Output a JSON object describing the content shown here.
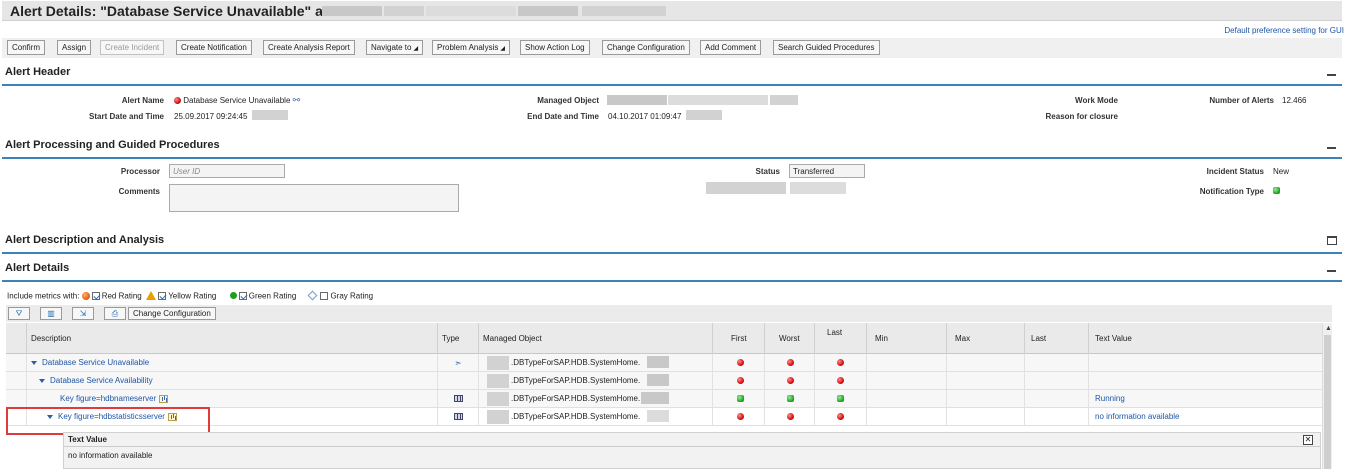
{
  "title": "Alert Details: \"Database Service Unavailable\" at",
  "pref_link": "Default preference setting for GUI",
  "toolbar": [
    {
      "label": "Confirm",
      "disabled": false,
      "dropdown": false
    },
    {
      "label": "Assign",
      "disabled": false,
      "dropdown": false
    },
    {
      "label": "Create Incident",
      "disabled": true,
      "dropdown": false
    },
    {
      "label": "Create Notification",
      "disabled": false,
      "dropdown": false
    },
    {
      "label": "Create Analysis Report",
      "disabled": false,
      "dropdown": false
    },
    {
      "label": "Navigate to",
      "disabled": false,
      "dropdown": true
    },
    {
      "label": "Problem Analysis",
      "disabled": false,
      "dropdown": true
    },
    {
      "label": "Show Action Log",
      "disabled": false,
      "dropdown": false
    },
    {
      "label": "Change Configuration",
      "disabled": false,
      "dropdown": false
    },
    {
      "label": "Add Comment",
      "disabled": false,
      "dropdown": false
    },
    {
      "label": "Search Guided Procedures",
      "disabled": false,
      "dropdown": false
    }
  ],
  "alert_header": {
    "section_title": "Alert Header",
    "alert_name_label": "Alert Name",
    "alert_name_value": "Database Service Unavailable",
    "start_label": "Start Date and Time",
    "start_value": "25.09.2017 09:24:45",
    "managed_object_label": "Managed Object",
    "end_label": "End Date and Time",
    "end_value": "04.10.2017 01:09:47",
    "work_mode_label": "Work Mode",
    "reason_label": "Reason for closure",
    "num_alerts_label": "Number of Alerts",
    "num_alerts_value": "12.466"
  },
  "processing": {
    "section_title": "Alert Processing and Guided Procedures",
    "processor_label": "Processor",
    "processor_placeholder": "User ID",
    "comments_label": "Comments",
    "status_label": "Status",
    "status_value": "Transferred",
    "incident_status_label": "Incident Status",
    "incident_status_value": "New",
    "notification_type_label": "Notification Type"
  },
  "description_section": {
    "section_title": "Alert Description and Analysis"
  },
  "details": {
    "section_title": "Alert Details",
    "include_metrics_label": "Include metrics with:",
    "red_rating": "Red Rating",
    "yellow_rating": "Yellow Rating",
    "green_rating": "Green Rating",
    "gray_rating": "Gray Rating",
    "change_config_label": "Change Configuration",
    "columns": [
      "Description",
      "Type",
      "Managed Object",
      "First",
      "Worst",
      "Last",
      "Min",
      "Max",
      "Last",
      "Text Value"
    ],
    "rows": [
      {
        "description": "Database Service Unavailable",
        "indent": 0,
        "type": "arrow",
        "managed_object": ".DBTypeForSAP.HDB.SystemHome.",
        "first": "red",
        "worst": "red",
        "last": "red",
        "text_value": ""
      },
      {
        "description": "Database Service Availability",
        "indent": 1,
        "type": "",
        "managed_object": ".DBTypeForSAP.HDB.SystemHome.",
        "first": "red",
        "worst": "red",
        "last": "red",
        "text_value": ""
      },
      {
        "description": "Key figure=hdbnameserver",
        "indent": 2,
        "type": "grid",
        "managed_object": ".DBTypeForSAP.HDB.SystemHome.",
        "first": "green",
        "worst": "green",
        "last": "green",
        "text_value": "Running"
      },
      {
        "description": "Key figure=hdbstatisticsserver",
        "indent": 1,
        "type": "grid",
        "managed_object": ".DBTypeForSAP.HDB.SystemHome.",
        "first": "red",
        "worst": "red",
        "last": "red",
        "text_value": "no information available"
      }
    ],
    "text_value_panel": {
      "header": "Text Value",
      "body": "no information available"
    }
  }
}
